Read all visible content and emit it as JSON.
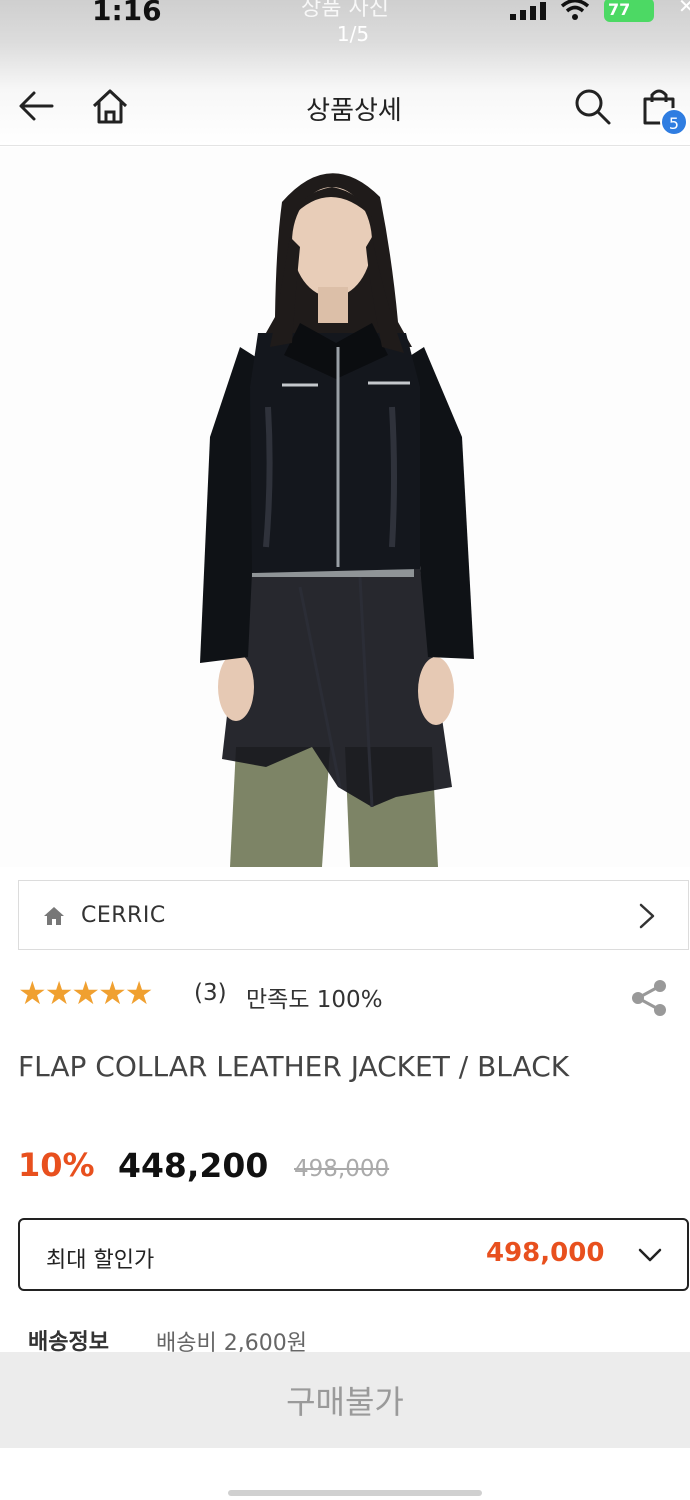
{
  "status_bar": {
    "time": "1:16",
    "story_title": "상품 사진",
    "story_counter": "1/5",
    "battery": "77",
    "signal_icon": "signal-bars-icon",
    "wifi_icon": "wifi-icon"
  },
  "header": {
    "title": "상품상세",
    "cart_count": "5",
    "icons": [
      "back-arrow-icon",
      "home-icon",
      "search-icon",
      "shopping-bag-icon"
    ]
  },
  "brand": {
    "name": "CERRIC",
    "icon": "home-icon"
  },
  "rating": {
    "stars": "★★★★★",
    "review_count": "(3)",
    "satisfaction": "만족도 100%"
  },
  "product": {
    "name": "FLAP COLLAR LEATHER JACKET / BLACK",
    "discount_rate": "10%",
    "sale_price": "448,200",
    "original_price": "498,000"
  },
  "max_discount": {
    "label": "최대 할인가",
    "value": "498,000"
  },
  "shipping": {
    "label": "배송정보",
    "value": "배송비 2,600원"
  },
  "buy_button": {
    "label": "구매불가"
  },
  "colors": {
    "accent": "#e8501e",
    "star": "#f0a030",
    "badge": "#2f7de1"
  }
}
